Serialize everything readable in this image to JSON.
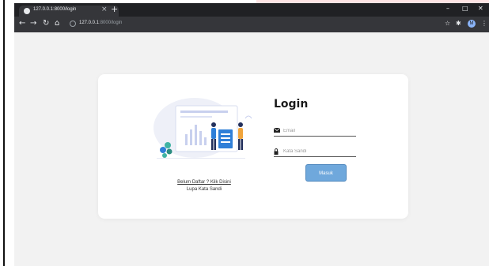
{
  "browser": {
    "tab_title": "127.0.0.1:8000/login",
    "tab_close": "×",
    "new_tab": "+",
    "window_controls": {
      "minimize": "–",
      "maximize": "□",
      "close": "✕"
    },
    "url_host": "127.0.0.1",
    "url_rest": ":8000/login"
  },
  "icons": {
    "back": "arrow-left-icon",
    "forward": "arrow-right-icon",
    "reload": "reload-icon",
    "home": "home-icon",
    "star": "star-icon",
    "extensions": "puzzle-icon",
    "menu": "kebab-menu-icon",
    "email": "envelope-icon",
    "password": "lock-icon"
  },
  "profile": {
    "initial": "M"
  },
  "login": {
    "title": "Login",
    "email_placeholder": "Email",
    "password_placeholder": "Kata Sandi",
    "submit_label": "Masuk",
    "register_link": "Belum Daftar ? Klik Disini",
    "forgot_link": "Lupa Kata Sandi"
  },
  "colors": {
    "accent": "#6fa8dc",
    "page_background": "#f2f2f2",
    "card_background": "#ffffff",
    "browser_dark": "#202124"
  }
}
